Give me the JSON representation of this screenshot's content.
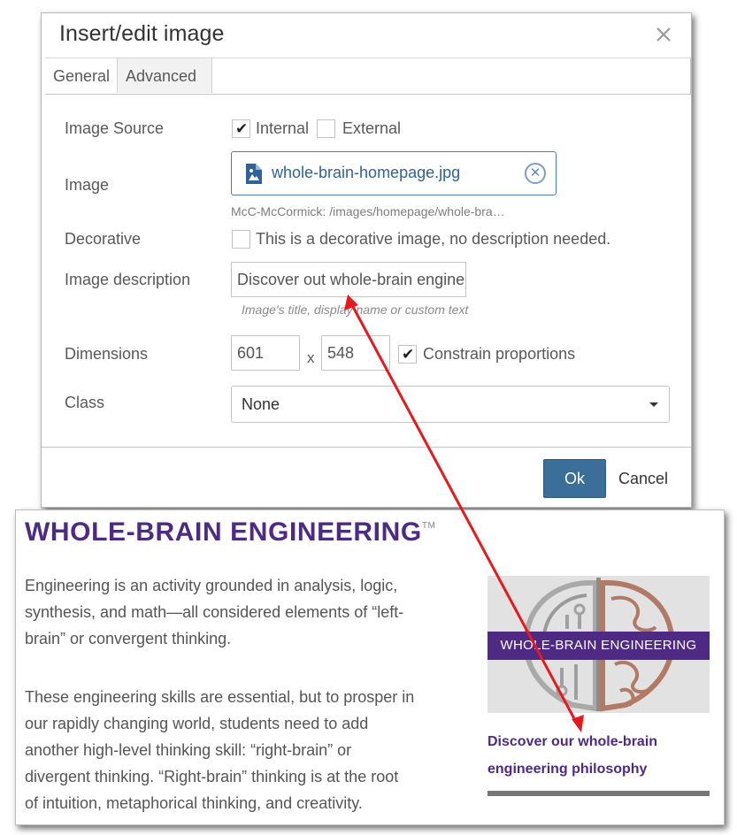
{
  "dialog": {
    "title": "Insert/edit image",
    "close_icon": "close-icon",
    "tabs": [
      {
        "label": "General",
        "active": true
      },
      {
        "label": "Advanced",
        "active": false
      }
    ],
    "image_source": {
      "label": "Image Source",
      "internal_label": "Internal",
      "internal_checked": true,
      "external_label": "External",
      "external_checked": false
    },
    "image": {
      "label": "Image",
      "file_name": "whole-brain-homepage.jpg",
      "file_icon": "image-file-icon",
      "remove_icon": "clear-circle-icon",
      "path": "McC-McCormick: /images/homepage/whole-bra…"
    },
    "decorative": {
      "label": "Decorative",
      "checked": false,
      "checkbox_label": "This is a decorative image, no description needed."
    },
    "description": {
      "label": "Image description",
      "value": "Discover out whole-brain engine",
      "hint": "Image's title, display name or custom text"
    },
    "dimensions": {
      "label": "Dimensions",
      "width": "601",
      "separator": "x",
      "height": "548",
      "constrain_label": "Constrain proportions",
      "constrain_checked": true
    },
    "class_field": {
      "label": "Class",
      "value": "None"
    },
    "buttons": {
      "ok": "Ok",
      "cancel": "Cancel"
    }
  },
  "page": {
    "heading": "WHOLE-BRAIN ENGINEERING",
    "trademark": "TM",
    "paragraph1_lines": [
      "Engineering is an activity grounded in analysis, logic,",
      "synthesis, and math—all considered elements of “left-",
      "brain” or convergent thinking."
    ],
    "paragraph2_lines": [
      "These engineering skills are essential, but to prosper in",
      "our rapidly changing world, students need to add",
      "another high-level thinking skill: “right-brain” or",
      "divergent thinking. “Right-brain” thinking is at the root",
      "of intuition, metaphorical thinking, and creativity."
    ],
    "image_banner": "WHOLE-BRAIN ENGINEERING",
    "caption_lines": [
      "Discover our whole-brain",
      "engineering philosophy"
    ]
  },
  "colors": {
    "brand_purple": "#4e2a84",
    "ok_button": "#3b6e98",
    "link_blue": "#2f6299",
    "annotation_arrow": "#e8191c"
  }
}
